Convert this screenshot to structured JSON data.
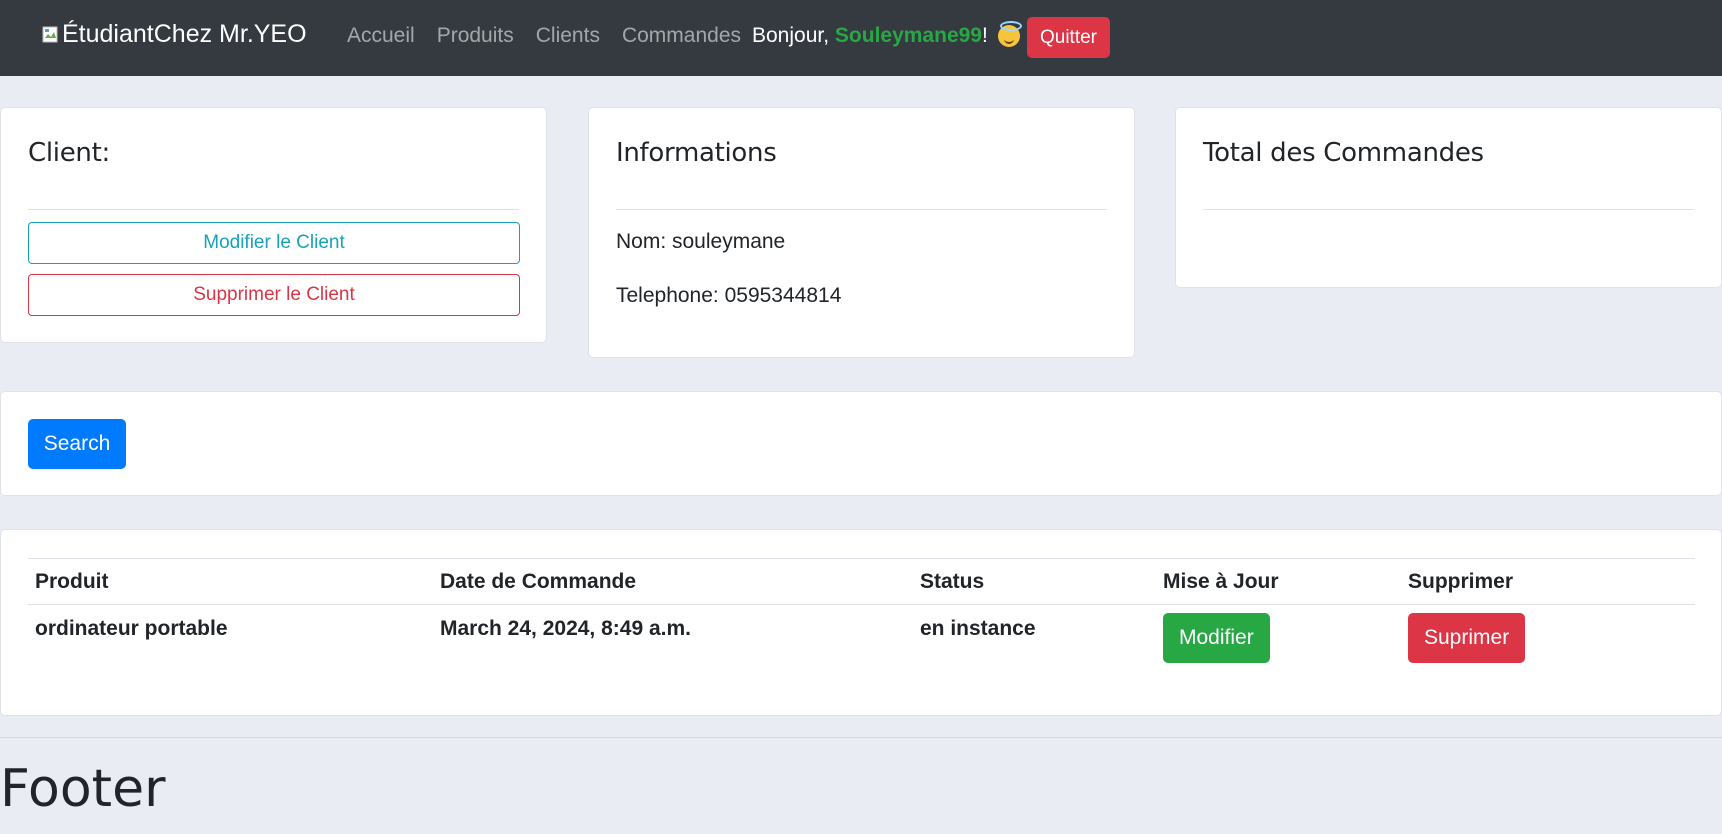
{
  "navbar": {
    "brand": "ÉtudiantChez Mr.YEO",
    "links": [
      "Accueil",
      "Produits",
      "Clients",
      "Commandes"
    ],
    "greeting_prefix": "Bonjour, ",
    "username": "Souleymane99",
    "greeting_suffix": "!",
    "quit_label": "Quitter"
  },
  "client_card": {
    "title": "Client:",
    "edit_label": "Modifier le Client",
    "delete_label": "Supprimer le Client"
  },
  "info_card": {
    "title": "Informations",
    "name_line": "Nom: souleymane",
    "phone_line": "Telephone: 0595344814"
  },
  "total_card": {
    "title": "Total des Commandes"
  },
  "search": {
    "button_label": "Search"
  },
  "orders": {
    "headers": [
      "Produit",
      "Date de Commande",
      "Status",
      "Mise à Jour",
      "Supprimer"
    ],
    "rows": [
      {
        "product": "ordinateur portable",
        "date": "March 24, 2024, 8:49 a.m.",
        "status": "en instance",
        "update_label": "Modifier",
        "delete_label": "Suprimer"
      }
    ]
  },
  "footer": {
    "text": "Footer"
  },
  "colors": {
    "navbar": "#343a40",
    "username": "#28a745",
    "danger": "#dc3545",
    "primary": "#007bff",
    "info": "#17a2b8",
    "success": "#28a745"
  }
}
